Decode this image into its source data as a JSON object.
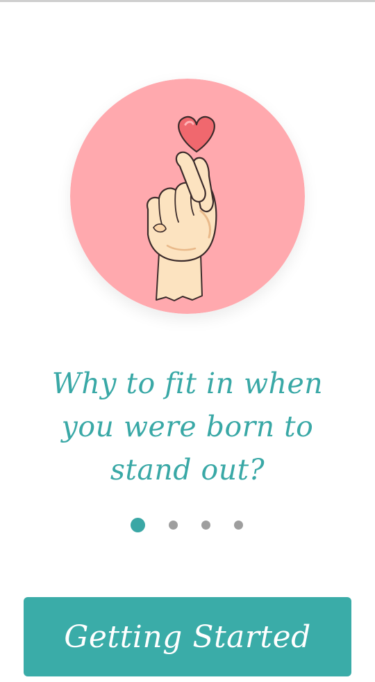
{
  "onboarding": {
    "quote_lines": [
      "Why to fit in when",
      "you were born to",
      "stand out?"
    ],
    "page_indicator": {
      "total": 4,
      "active_index": 0
    },
    "cta_label": "Getting Started"
  },
  "illustration": {
    "icon": "finger-heart-icon"
  },
  "colors": {
    "accent": "#3aaca8",
    "hero_background": "#ffa9ae",
    "heart": "#f0686e",
    "skin": "#fce3c0",
    "inactive_dot": "#9e9e9e"
  }
}
